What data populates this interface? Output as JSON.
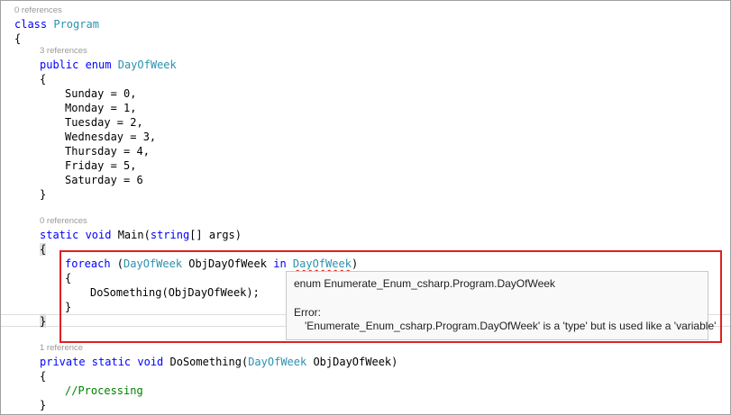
{
  "code_lens": {
    "class_refs": "0 references",
    "enum_refs": "3 references",
    "main_refs": "0 references",
    "dosomething_refs": "1 reference"
  },
  "code": {
    "class_kw": "class",
    "class_name": "Program",
    "open_brace": "{",
    "close_brace": "}",
    "enum_modifiers": "public enum",
    "enum_name": "DayOfWeek",
    "enum_members": [
      "Sunday = 0,",
      "Monday = 1,",
      "Tuesday = 2,",
      "Wednesday = 3,",
      "Thursday = 4,",
      "Friday = 5,",
      "Saturday = 6"
    ],
    "main_modifiers": "static void",
    "main_sig_pre": " Main(",
    "main_param_type": "string",
    "main_sig_post": "[] args)",
    "foreach_kw": "foreach",
    "foreach_open": " (",
    "foreach_type": "DayOfWeek",
    "foreach_var": " ObjDayOfWeek ",
    "in_kw": "in",
    "foreach_error_token": "DayOfWeek",
    "foreach_close": ")",
    "call_stmt": "DoSomething(ObjDayOfWeek);",
    "dosomething_modifiers": "private static void",
    "dosomething_name": " DoSomething(",
    "dosomething_param_type": "DayOfWeek",
    "dosomething_param": " ObjDayOfWeek)",
    "comment": "//Processing"
  },
  "tooltip": {
    "signature": "enum Enumerate_Enum_csharp.Program.DayOfWeek",
    "error_label": "Error:",
    "error_message": "'Enumerate_Enum_csharp.Program.DayOfWeek' is a 'type' but is used like a 'variable'"
  },
  "colors": {
    "keyword": "#0000ff",
    "type": "#2b91af",
    "comment": "#008000",
    "error_squiggle": "#e51400",
    "highlight_box": "#e02020"
  }
}
